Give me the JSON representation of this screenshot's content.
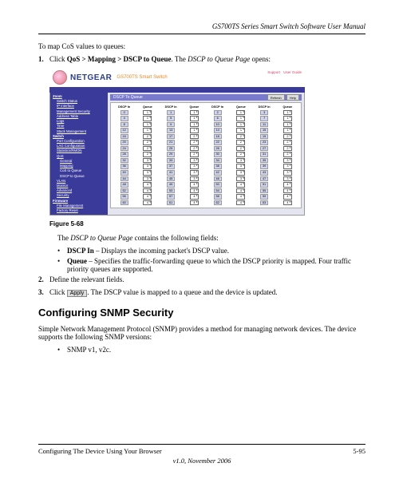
{
  "doc": {
    "title": "GS700TS Series Smart Switch Software User Manual",
    "intro": "To map CoS values to queues:",
    "figure_label": "Figure 5-68",
    "desc_intro_prefix": "The ",
    "desc_intro_em": "DSCP to Queue Page",
    "desc_intro_suffix": " contains the following fields:",
    "h2": "Configuring SNMP Security",
    "snmp_para": "Simple Network Management Protocol (SNMP) provides a method for managing network devices. The device supports the following SNMP versions:"
  },
  "steps": {
    "s1": {
      "num": "1.",
      "pre": "Click ",
      "b": "QoS > Mapping > DSCP to Queue",
      "mid": ". The ",
      "em": "DSCP to Queue Page",
      "post": " opens:"
    },
    "s2": {
      "num": "2.",
      "text": "Define the relevant fields."
    },
    "s3": {
      "num": "3.",
      "pre": "Click ",
      "btn": "Apply",
      "post": ". The DSCP value is mapped to a queue and the device is updated."
    }
  },
  "fields": {
    "f1": {
      "name": "DSCP In",
      "desc": " – Displays the incoming packet's DSCP value."
    },
    "f2": {
      "name": "Queue",
      "desc": " – Specifies the traffic-forwarding queue to which the DSCP priority is mapped. Four traffic priority queues are supported."
    }
  },
  "snmp_versions": {
    "v1": "SNMP v1, v2c."
  },
  "footer": {
    "left": "Configuring The Device Using Your Browser",
    "right": "5-95",
    "version": "v1.0, November 2006"
  },
  "screenshot": {
    "brand": "NETGEAR",
    "product": "GS700TS Smart Switch",
    "links": {
      "a": "Support",
      "b": "User Guide"
    },
    "panel_title": "DSCP To Queue",
    "btns": {
      "refresh": "Refresh",
      "help": "Help"
    },
    "headers": [
      "DSCP In",
      "Queue",
      "DSCP In",
      "Queue",
      "DSCP In",
      "Queue",
      "DSCP In",
      "Queue"
    ],
    "nav": [
      {
        "t": "Zoom",
        "c": "hd"
      },
      {
        "t": "Switch Status",
        "c": "ul sub"
      },
      {
        "t": "IP Interface",
        "c": "ul sub"
      },
      {
        "t": "Management Security",
        "c": "ul sub"
      },
      {
        "t": "Address Table",
        "c": "ul sub"
      },
      {
        "t": "Logs",
        "c": "ul sub"
      },
      {
        "t": "Time",
        "c": "ul sub"
      },
      {
        "t": "Stack Management",
        "c": "ul sub"
      },
      {
        "t": "Switch",
        "c": "hd"
      },
      {
        "t": "Port Configuration",
        "c": "ul sub"
      },
      {
        "t": "LAG Configuration",
        "c": "ul sub"
      },
      {
        "t": "Statistics/RMON",
        "c": "ul sub"
      },
      {
        "t": "QoS",
        "c": "ul sub"
      },
      {
        "t": "General",
        "c": "ul sub2"
      },
      {
        "t": "Mapping",
        "c": "ul sub2"
      },
      {
        "t": "CoS to Queue",
        "c": "sub2"
      },
      {
        "t": "DSCP to Queue",
        "c": "sub2"
      },
      {
        "t": "VLAN",
        "c": "ul sub"
      },
      {
        "t": "Monitor",
        "c": "ul sub"
      },
      {
        "t": "Advanced",
        "c": "ul sub"
      },
      {
        "t": "Security",
        "c": "ul sub"
      },
      {
        "t": "Firmware",
        "c": "hd"
      },
      {
        "t": "File Management",
        "c": "ul sub"
      },
      {
        "t": "Factory Reset",
        "c": "ul sub"
      }
    ],
    "table": [
      [
        {
          "d": "0",
          "q": "1"
        },
        {
          "d": "1",
          "q": "1"
        },
        {
          "d": "2",
          "q": "1"
        },
        {
          "d": "3",
          "q": "1"
        }
      ],
      [
        {
          "d": "4",
          "q": "1"
        },
        {
          "d": "5",
          "q": "1"
        },
        {
          "d": "6",
          "q": "1"
        },
        {
          "d": "7",
          "q": "1"
        }
      ],
      [
        {
          "d": "8",
          "q": "1"
        },
        {
          "d": "9",
          "q": "1"
        },
        {
          "d": "10",
          "q": "1"
        },
        {
          "d": "11",
          "q": "1"
        }
      ],
      [
        {
          "d": "12",
          "q": "1"
        },
        {
          "d": "13",
          "q": "1"
        },
        {
          "d": "14",
          "q": "1"
        },
        {
          "d": "15",
          "q": "1"
        }
      ],
      [
        {
          "d": "16",
          "q": "2"
        },
        {
          "d": "17",
          "q": "2"
        },
        {
          "d": "18",
          "q": "2"
        },
        {
          "d": "19",
          "q": "2"
        }
      ],
      [
        {
          "d": "20",
          "q": "2"
        },
        {
          "d": "21",
          "q": "2"
        },
        {
          "d": "22",
          "q": "2"
        },
        {
          "d": "23",
          "q": "2"
        }
      ],
      [
        {
          "d": "24",
          "q": "2"
        },
        {
          "d": "25",
          "q": "2"
        },
        {
          "d": "26",
          "q": "2"
        },
        {
          "d": "27",
          "q": "2"
        }
      ],
      [
        {
          "d": "28",
          "q": "2"
        },
        {
          "d": "29",
          "q": "2"
        },
        {
          "d": "30",
          "q": "2"
        },
        {
          "d": "31",
          "q": "2"
        }
      ],
      [
        {
          "d": "32",
          "q": "3"
        },
        {
          "d": "33",
          "q": "3"
        },
        {
          "d": "34",
          "q": "3"
        },
        {
          "d": "35",
          "q": "3"
        }
      ],
      [
        {
          "d": "36",
          "q": "3"
        },
        {
          "d": "37",
          "q": "3"
        },
        {
          "d": "38",
          "q": "3"
        },
        {
          "d": "39",
          "q": "3"
        }
      ],
      [
        {
          "d": "40",
          "q": "3"
        },
        {
          "d": "41",
          "q": "3"
        },
        {
          "d": "42",
          "q": "3"
        },
        {
          "d": "43",
          "q": "3"
        }
      ],
      [
        {
          "d": "44",
          "q": "3"
        },
        {
          "d": "45",
          "q": "3"
        },
        {
          "d": "46",
          "q": "3"
        },
        {
          "d": "47",
          "q": "3"
        }
      ],
      [
        {
          "d": "48",
          "q": "4"
        },
        {
          "d": "49",
          "q": "4"
        },
        {
          "d": "50",
          "q": "4"
        },
        {
          "d": "51",
          "q": "4"
        }
      ],
      [
        {
          "d": "52",
          "q": "4"
        },
        {
          "d": "53",
          "q": "4"
        },
        {
          "d": "54",
          "q": "4"
        },
        {
          "d": "55",
          "q": "4"
        }
      ],
      [
        {
          "d": "56",
          "q": "4"
        },
        {
          "d": "57",
          "q": "4"
        },
        {
          "d": "58",
          "q": "4"
        },
        {
          "d": "59",
          "q": "4"
        }
      ],
      [
        {
          "d": "60",
          "q": "4"
        },
        {
          "d": "61",
          "q": "4"
        },
        {
          "d": "62",
          "q": "4"
        },
        {
          "d": "63",
          "q": "4"
        }
      ]
    ]
  }
}
